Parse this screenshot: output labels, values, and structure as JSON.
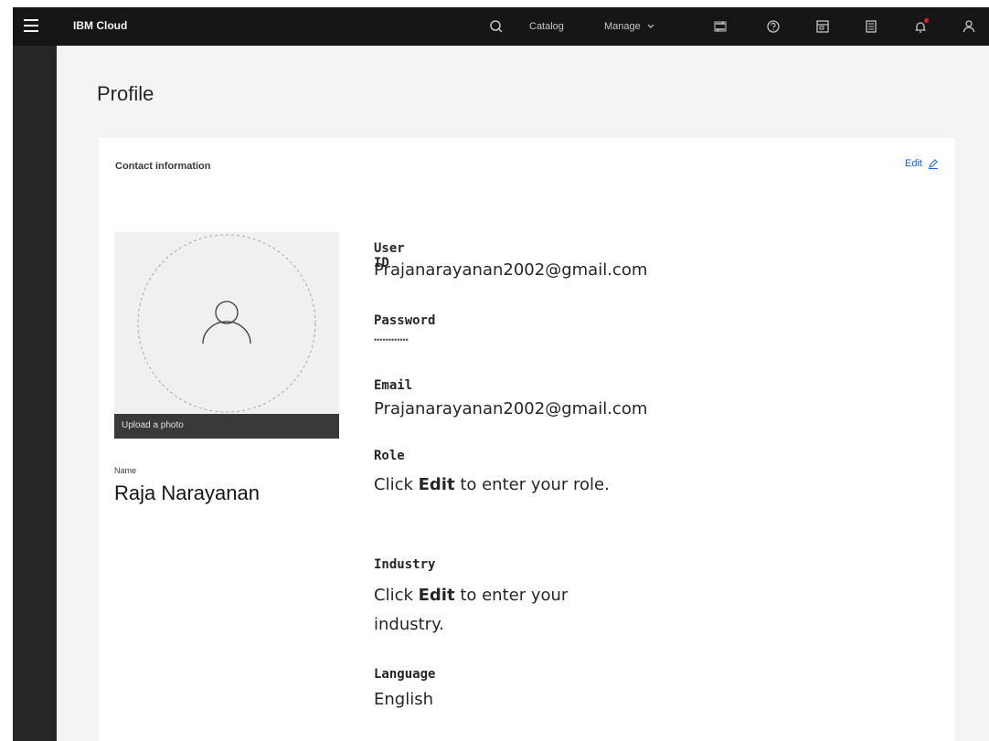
{
  "header": {
    "brand": "IBM Cloud",
    "catalog": "Catalog",
    "manage": "Manage"
  },
  "page": {
    "title": "Profile"
  },
  "card": {
    "title": "Contact information",
    "edit_label": "Edit"
  },
  "photo": {
    "upload_label": "Upload a photo"
  },
  "name": {
    "label": "Name",
    "value": "Raja Narayanan"
  },
  "fields": {
    "user_id": {
      "label": "User ID",
      "value": "Prajanarayanan2002@gmail.com"
    },
    "password": {
      "label": "Password",
      "value": "••••••••••••"
    },
    "email": {
      "label": "Email",
      "value": "Prajanarayanan2002@gmail.com"
    },
    "role": {
      "label": "Role",
      "value_prefix": "Click ",
      "value_bold": "Edit",
      "value_suffix": " to enter your role."
    },
    "industry": {
      "label": "Industry",
      "value_prefix": "Click ",
      "value_bold": "Edit",
      "value_suffix": " to enter your industry."
    },
    "language": {
      "label": "Language",
      "value": "English"
    }
  },
  "colors": {
    "topbar": "#161616",
    "rail": "#262626",
    "accent": "#0f62fe",
    "notification": "#da1e28"
  },
  "icons": {
    "menu": "hamburger-icon",
    "search": "search-icon",
    "switch": "switcher-icon",
    "help": "help-icon",
    "calendar": "cost-estimator-icon",
    "docs": "docs-icon",
    "notifications": "notification-icon",
    "user": "user-icon"
  }
}
